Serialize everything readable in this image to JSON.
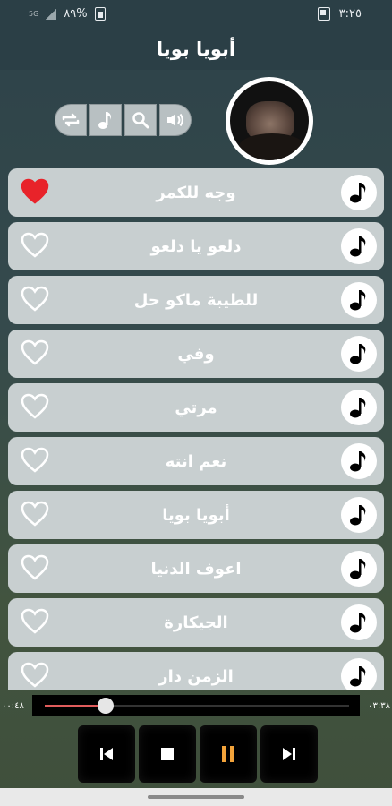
{
  "status": {
    "time": "٣:٢٥",
    "battery": "%٨٩",
    "network": "5G"
  },
  "header": {
    "title": "أبويا بويا"
  },
  "controls": [
    {
      "icon": "repeat-icon"
    },
    {
      "icon": "music-note-icon"
    },
    {
      "icon": "search-icon"
    },
    {
      "icon": "volume-icon"
    }
  ],
  "songs": [
    {
      "title": "وجه للكمر",
      "favorite": true
    },
    {
      "title": "دلعو يا دلعو",
      "favorite": false
    },
    {
      "title": "للطيبة ماكو حل",
      "favorite": false
    },
    {
      "title": "وفي",
      "favorite": false
    },
    {
      "title": "مرتي",
      "favorite": false
    },
    {
      "title": "نعم انته",
      "favorite": false
    },
    {
      "title": "أبويا بويا",
      "favorite": false
    },
    {
      "title": "اعوف الدنيا",
      "favorite": false
    },
    {
      "title": "الجيكارة",
      "favorite": false
    },
    {
      "title": "الزمن دار",
      "favorite": false
    }
  ],
  "player": {
    "elapsed": "٠٣:٣٨",
    "duration": "٠٠:٤٨",
    "progress": 0.2,
    "progress_color": "#e05c5c"
  },
  "colors": {
    "accent_heart": "#e8232a",
    "row_bg": "#c8cfd0",
    "header_bg": "#2b3f46"
  }
}
